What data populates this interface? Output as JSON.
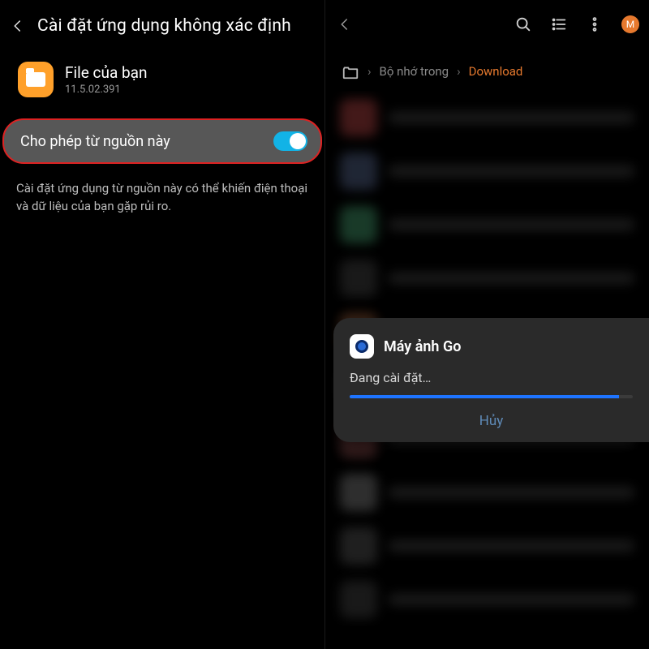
{
  "left": {
    "title": "Cài đặt ứng dụng không xác định",
    "app_name": "File của bạn",
    "app_version": "11.5.02.391",
    "toggle_label": "Cho phép từ nguồn này",
    "toggle_on": true,
    "risk_text": "Cài đặt ứng dụng từ nguồn này có thể khiến điện thoại và dữ liệu của bạn gặp rủi ro."
  },
  "right": {
    "avatar_letter": "M",
    "breadcrumb": {
      "home_icon": "home",
      "internal": "Bộ nhớ trong",
      "current": "Download"
    },
    "dialog": {
      "app_name": "Máy ảnh Go",
      "status": "Đang cài đặt…",
      "cancel": "Hủy"
    }
  }
}
